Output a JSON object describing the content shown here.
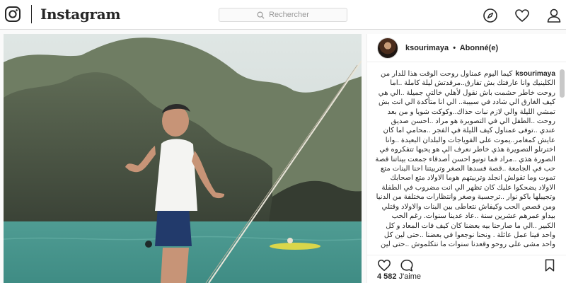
{
  "brand": {
    "wordmark": "Instagram"
  },
  "search": {
    "placeholder": "Rechercher"
  },
  "nav": {
    "icons": [
      "explore-icon",
      "heart-icon",
      "profile-icon"
    ]
  },
  "post": {
    "username": "ksourimaya",
    "separator": "•",
    "follow_status": "Abonné(e)",
    "caption_user": "ksourimaya",
    "caption_text": "كيما اليوم عمناول روحت الوقت هذا للدار من الكلينيك وانا عارفتك بش تفارق..مرقدتش ليلة كاملة ..اما روحت خاطر حشمت باش نقول لأهلي خالتي جميلة ..الي هي كيف الغارق الي شادد في سبيبة.. الي انا متأكدة الي انت بش تمشي الليلة والي لازم نبات حذاك..وكوكت شويا و من بعد روحت ..الطفل الي في التصويرة هو مراد ..احسن صديق عندي ..توفى عمناول كيف الليلة في الفجر ..محامي اما كان عايش كمغامر..يموت على الفوياجات والبلدان البعيدة ..وانا اخترتلو التصويرة هذي خاطر نعرف الي هو يحبها تتفكروه في الصورة هذي ..مراد فما تونيو احسن أصدقاء جمعت بيناتنا قصة حب في الجامعة ..قصة فسدها الصغر وتربيتنا احنا البنات متع تموت وما تقولش انجلد وتربيتهم هوما الاولاد متع اصحابك الاولاد يضحكوا عليك كان تظهر الي انت مضروب في الطفلة وتجيبلها باكو نوار ..ترجسية وصغر وانتظارات مختلفة من الدنيا ومن قصص الحب وكيفاش نتعاطى بين البنات والاولاد وقتلي بيداو عمرهم عشرين سنة ..عاد عدينا سنوات. رغم الحب الكبير ..الي ما صارحنا بيه بعضنا كان كيف فات المعاد و كل واحد فينا عمل عائلة . ونحنا نوجعوا في بعضنا ..حتى لين كل واحد مشى على روحو وقعدنا سنوات ما نتكلموش ..حتى لين",
    "likes_count": "4 582",
    "likes_label": "J'aime"
  }
}
